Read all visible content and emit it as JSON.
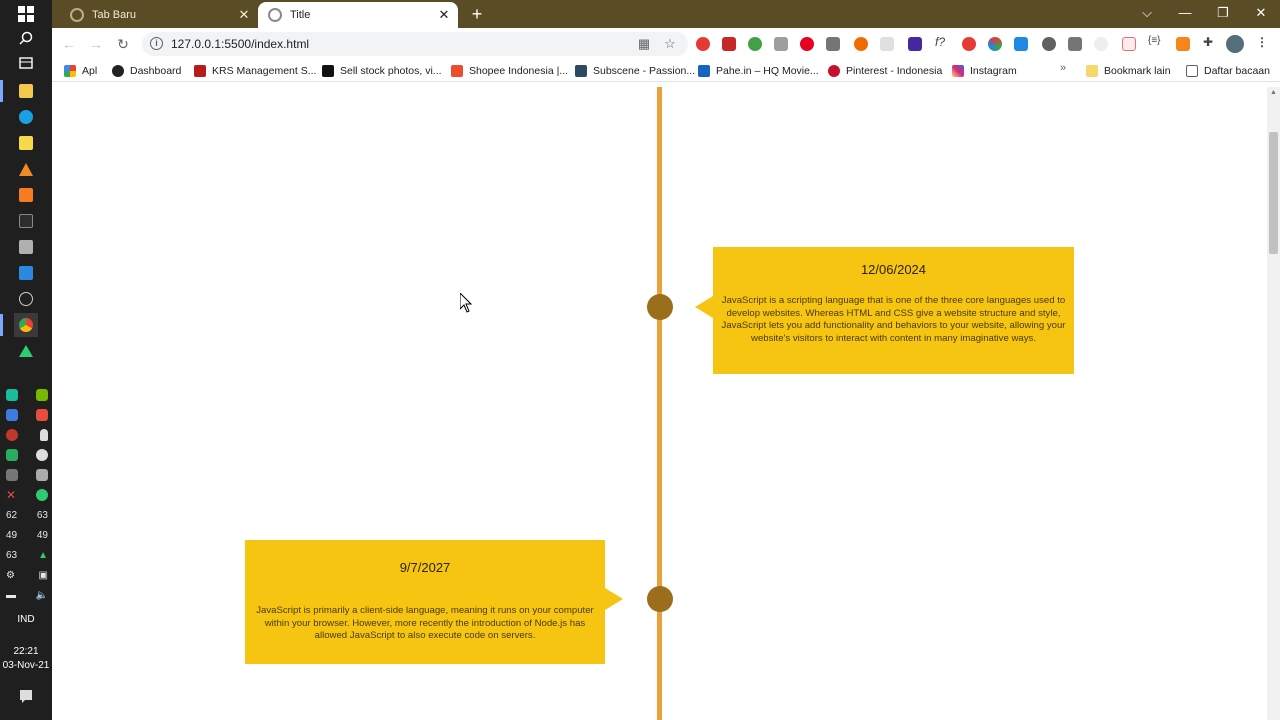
{
  "browser": {
    "tabs": [
      {
        "title": "Tab Baru",
        "active": false
      },
      {
        "title": "Title",
        "active": true
      }
    ],
    "new_tab_label": "+",
    "url": "127.0.0.1:5500/index.html",
    "window_controls": {
      "collapse": "⌵",
      "minimize": "—",
      "restore": "❐",
      "close": "✕"
    }
  },
  "bookmarks": {
    "items": [
      {
        "label": "Apl",
        "color": "#e64a19"
      },
      {
        "label": "Dashboard",
        "color": "#222222"
      },
      {
        "label": "KRS Management S...",
        "color": "#b71c1c"
      },
      {
        "label": "Sell stock photos, vi...",
        "color": "#111111"
      },
      {
        "label": "Shopee Indonesia |...",
        "color": "#ee4d2d"
      },
      {
        "label": "Subscene - Passion...",
        "color": "#2e4a62"
      },
      {
        "label": "Pahe.in – HQ Movie...",
        "color": "#1565c0"
      },
      {
        "label": "Pinterest - Indonesia",
        "color": "#c8102e"
      },
      {
        "label": "Instagram",
        "color": "#d62976"
      }
    ],
    "more": "»",
    "other_bookmarks": "Bookmark lain",
    "reading_list": "Daftar bacaan"
  },
  "taskbar": {
    "tray_rows": [
      [
        "62",
        "63"
      ],
      [
        "49",
        "49"
      ],
      [
        "63",
        "▲"
      ]
    ],
    "language": "IND",
    "time": "22:21",
    "date": "03-Nov-21"
  },
  "timeline": {
    "entries": [
      {
        "date": "12/06/2024",
        "text": "JavaScript is a scripting language that is one of the three core languages used to develop websites. Whereas HTML and CSS give a website structure and style, JavaScript lets you add functionality and behaviors to your website, allowing your website's visitors to interact with content in many imaginative ways.",
        "side": "right"
      },
      {
        "date": "9/7/2027",
        "text": "JavaScript is primarily a client-side language, meaning it runs on your computer within your browser. However, more recently the introduction of Node.js has allowed JavaScript to also execute code on servers.",
        "side": "left"
      }
    ],
    "colors": {
      "line": "#e9a23b",
      "node": "#9b6e1c",
      "card": "#f6c511"
    }
  }
}
